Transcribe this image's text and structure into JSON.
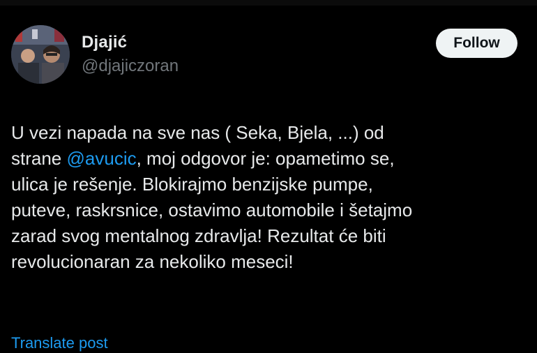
{
  "author": {
    "display_name": "Djajić",
    "handle": "@djajiczoran",
    "avatar_icon": "profile-photo"
  },
  "follow_button": {
    "label": "Follow"
  },
  "tweet": {
    "lines": [
      {
        "text": "U vezi napada na sve nas ( Seka, Bjela, ...) od"
      },
      {
        "before": "strane ",
        "mention": "@avucic",
        "after": ", moj odgovor je: opametimo se,"
      },
      {
        "text": "ulica je rešenje. Blokirajmo benzijske pumpe,"
      },
      {
        "text": "puteve, raskrsnice, ostavimo automobile i šetajmo"
      },
      {
        "text": "zarad svog mentalnog zdravlja! Rezultat će biti"
      },
      {
        "text": "revolucionaran za nekoliko meseci!"
      }
    ]
  },
  "translate": {
    "label": "Translate post"
  },
  "colors": {
    "background": "#000000",
    "text": "#e7e9ea",
    "secondary": "#71767b",
    "link": "#1d9bf0",
    "button_bg": "#eff3f4"
  }
}
